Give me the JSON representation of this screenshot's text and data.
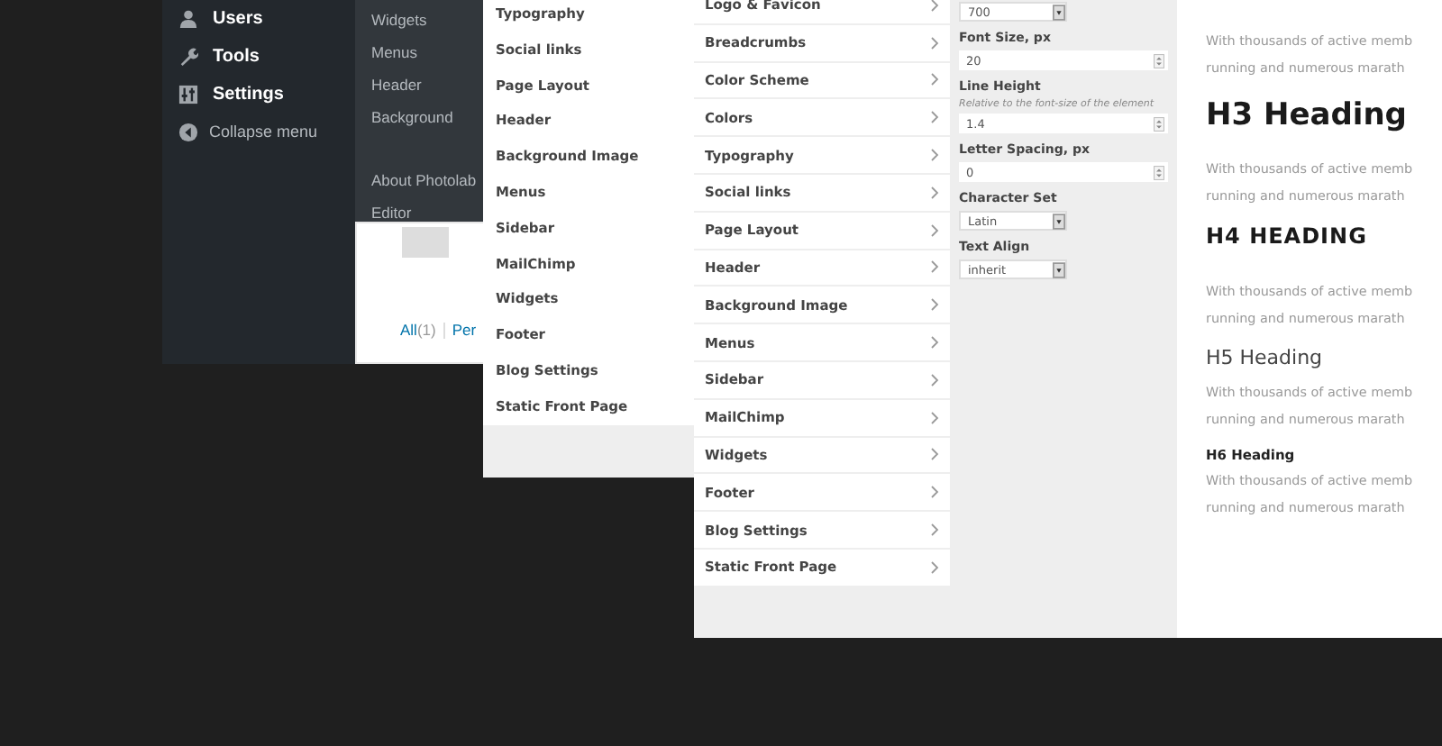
{
  "admin_menu": {
    "items": [
      {
        "label": "Users"
      },
      {
        "label": "Tools"
      },
      {
        "label": "Settings"
      }
    ],
    "collapse": "Collapse menu"
  },
  "submenu": {
    "groups": [
      [
        "Widgets",
        "Menus",
        "Header",
        "Background"
      ],
      [
        "About Photolab",
        "Editor"
      ]
    ]
  },
  "comments": {
    "filters": [
      {
        "label": "All",
        "count": "(1)"
      },
      {
        "label": "Per"
      }
    ]
  },
  "customizer_back": {
    "sections": [
      "Typography",
      "Social links",
      "Page Layout",
      "Header",
      "Background Image",
      "Menus",
      "Sidebar",
      "MailChimp",
      "Widgets",
      "Footer",
      "Blog Settings",
      "Static Front Page"
    ]
  },
  "customizer_front": {
    "sections": [
      "Logo & Favicon",
      "Breadcrumbs",
      "Color Scheme",
      "Colors",
      "Typography",
      "Social links",
      "Page Layout",
      "Header",
      "Background Image",
      "Menus",
      "Sidebar",
      "MailChimp",
      "Widgets",
      "Footer",
      "Blog Settings",
      "Static Front Page"
    ],
    "controls": [
      {
        "kind": "select",
        "value": "700"
      },
      {
        "kind": "number",
        "label": "Font Size, px",
        "value": "20"
      },
      {
        "kind": "number",
        "label": "Line Height",
        "note": "Relative to the font-size of the element",
        "value": "1.4"
      },
      {
        "kind": "number",
        "label": "Letter Spacing, px",
        "value": "0"
      },
      {
        "kind": "select",
        "label": "Character Set",
        "value": "Latin"
      },
      {
        "kind": "select",
        "label": "Text Align",
        "value": "inherit"
      }
    ]
  },
  "preview": {
    "blocks": [
      {
        "kind": "paragraph",
        "lines": [
          "With thousands of active memb",
          "running and numerous marath"
        ]
      },
      {
        "kind": "h3",
        "text": "H3 Heading"
      },
      {
        "kind": "paragraph",
        "lines": [
          "With thousands of active memb",
          "running and numerous marath"
        ]
      },
      {
        "kind": "h4",
        "text": "H4 HEADING"
      },
      {
        "kind": "paragraph",
        "lines": [
          "With thousands of active memb",
          "running and numerous marath"
        ]
      },
      {
        "kind": "h5",
        "text": "H5 Heading"
      },
      {
        "kind": "paragraph",
        "lines": [
          "With thousands of active memb",
          "running and numerous marath"
        ]
      },
      {
        "kind": "h6",
        "text": "H6 Heading"
      },
      {
        "kind": "paragraph",
        "lines": [
          "With thousands of active memb",
          "running and numerous marath"
        ]
      }
    ]
  }
}
